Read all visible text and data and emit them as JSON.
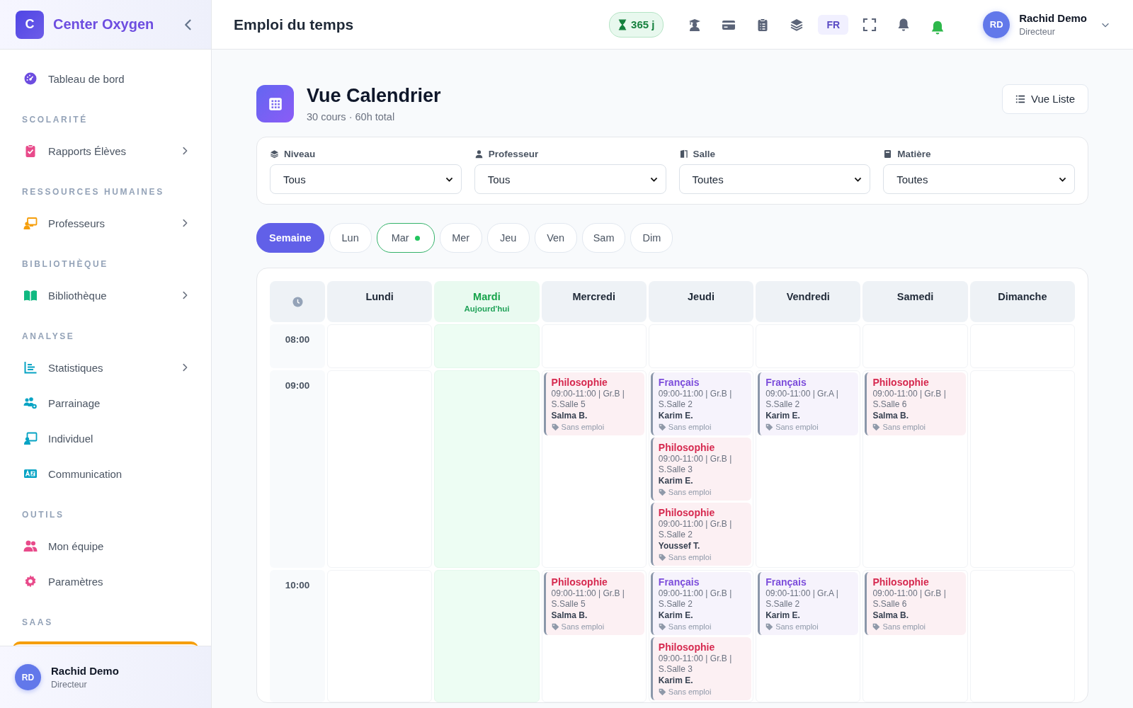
{
  "sidebar": {
    "brand": {
      "letter": "C",
      "name": "Center Oxygen"
    },
    "sections": [
      {
        "items": [
          {
            "label": "Tableau de bord",
            "color": "#6d4de0",
            "has_submenu": false
          }
        ]
      },
      {
        "title": "SCOLARITÉ",
        "items": [
          {
            "label": "Rapports Élèves",
            "color": "#e84a8a",
            "has_submenu": true
          }
        ]
      },
      {
        "title": "RESSOURCES HUMAINES",
        "items": [
          {
            "label": "Professeurs",
            "color": "#f59e0b",
            "has_submenu": true
          }
        ]
      },
      {
        "title": "BIBLIOTHÈQUE",
        "items": [
          {
            "label": "Bibliothèque",
            "color": "#10b981",
            "has_submenu": true
          }
        ]
      },
      {
        "title": "ANALYSE",
        "items": [
          {
            "label": "Statistiques",
            "color": "#06a3c4",
            "has_submenu": true
          },
          {
            "label": "Parrainage",
            "color": "#06a3c4",
            "has_submenu": false
          },
          {
            "label": "Individuel",
            "color": "#06a3c4",
            "has_submenu": false
          },
          {
            "label": "Communication",
            "color": "#06a3c4",
            "has_submenu": false
          }
        ]
      },
      {
        "title": "OUTILS",
        "items": [
          {
            "label": "Mon équipe",
            "color": "#e84a8a",
            "has_submenu": false
          },
          {
            "label": "Paramètres",
            "color": "#e84a8a",
            "has_submenu": false
          }
        ]
      },
      {
        "title": "SAAS"
      }
    ],
    "user": {
      "initials": "RD",
      "name": "Rachid Demo",
      "role": "Directeur"
    }
  },
  "topbar": {
    "title": "Emploi du temps",
    "days_left": "365 j",
    "language": "FR",
    "user": {
      "initials": "RD",
      "name": "Rachid Demo",
      "role": "Directeur"
    }
  },
  "page_header": {
    "title": "Vue Calendrier",
    "subtitle": "30 cours · 60h total",
    "button": "Vue Liste"
  },
  "filters": [
    {
      "label": "Niveau",
      "value": "Tous"
    },
    {
      "label": "Professeur",
      "value": "Tous"
    },
    {
      "label": "Salle",
      "value": "Toutes"
    },
    {
      "label": "Matière",
      "value": "Toutes"
    }
  ],
  "day_tabs": [
    {
      "label": "Semaine",
      "selected": true,
      "today": false
    },
    {
      "label": "Lun",
      "selected": false,
      "today": false
    },
    {
      "label": "Mar",
      "selected": false,
      "today": true
    },
    {
      "label": "Mer",
      "selected": false,
      "today": false
    },
    {
      "label": "Jeu",
      "selected": false,
      "today": false
    },
    {
      "label": "Ven",
      "selected": false,
      "today": false
    },
    {
      "label": "Sam",
      "selected": false,
      "today": false
    },
    {
      "label": "Dim",
      "selected": false,
      "today": false
    }
  ],
  "calendar": {
    "days": [
      {
        "name": "Lundi",
        "today": false
      },
      {
        "name": "Mardi",
        "subtitle": "Aujourd'hui",
        "today": true
      },
      {
        "name": "Mercredi",
        "today": false
      },
      {
        "name": "Jeudi",
        "today": false
      },
      {
        "name": "Vendredi",
        "today": false
      },
      {
        "name": "Samedi",
        "today": false
      },
      {
        "name": "Dimanche",
        "today": false
      }
    ],
    "rows": [
      {
        "time": "08:00",
        "cells": [
          [],
          [],
          [],
          [],
          [],
          [],
          []
        ]
      },
      {
        "time": "09:00",
        "cells": [
          [],
          [],
          [
            {
              "subject": "Philosophie",
              "color": "#d6294f",
              "info": "09:00-11:00 | Gr.B | S.Salle 5",
              "teacher": "Salma B.",
              "tag": "Sans emploi"
            }
          ],
          [
            {
              "subject": "Français",
              "color": "#7c4ddb",
              "info": "09:00-11:00 | Gr.B | S.Salle 2",
              "teacher": "Karim E.",
              "tag": "Sans emploi"
            },
            {
              "subject": "Philosophie",
              "color": "#d6294f",
              "info": "09:00-11:00 | Gr.B | S.Salle 3",
              "teacher": "Karim E.",
              "tag": "Sans emploi"
            },
            {
              "subject": "Philosophie",
              "color": "#d6294f",
              "info": "09:00-11:00 | Gr.B | S.Salle 2",
              "teacher": "Youssef T.",
              "tag": "Sans emploi"
            }
          ],
          [
            {
              "subject": "Français",
              "color": "#7c4ddb",
              "info": "09:00-11:00 | Gr.A | S.Salle 2",
              "teacher": "Karim E.",
              "tag": "Sans emploi"
            }
          ],
          [
            {
              "subject": "Philosophie",
              "color": "#d6294f",
              "info": "09:00-11:00 | Gr.B | S.Salle 6",
              "teacher": "Salma B.",
              "tag": "Sans emploi"
            }
          ],
          []
        ]
      },
      {
        "time": "10:00",
        "cells": [
          [],
          [],
          [
            {
              "subject": "Philosophie",
              "color": "#d6294f",
              "info": "09:00-11:00 | Gr.B | S.Salle 5",
              "teacher": "Salma B.",
              "tag": "Sans emploi"
            }
          ],
          [
            {
              "subject": "Français",
              "color": "#7c4ddb",
              "info": "09:00-11:00 | Gr.B | S.Salle 2",
              "teacher": "Karim E.",
              "tag": "Sans emploi"
            },
            {
              "subject": "Philosophie",
              "color": "#d6294f",
              "info": "09:00-11:00 | Gr.B | S.Salle 3",
              "teacher": "Karim E.",
              "tag": "Sans emploi"
            }
          ],
          [
            {
              "subject": "Français",
              "color": "#7c4ddb",
              "info": "09:00-11:00 | Gr.A | S.Salle 2",
              "teacher": "Karim E.",
              "tag": "Sans emploi"
            }
          ],
          [
            {
              "subject": "Philosophie",
              "color": "#d6294f",
              "info": "09:00-11:00 | Gr.B | S.Salle 6",
              "teacher": "Salma B.",
              "tag": "Sans emploi"
            }
          ],
          []
        ]
      }
    ]
  }
}
